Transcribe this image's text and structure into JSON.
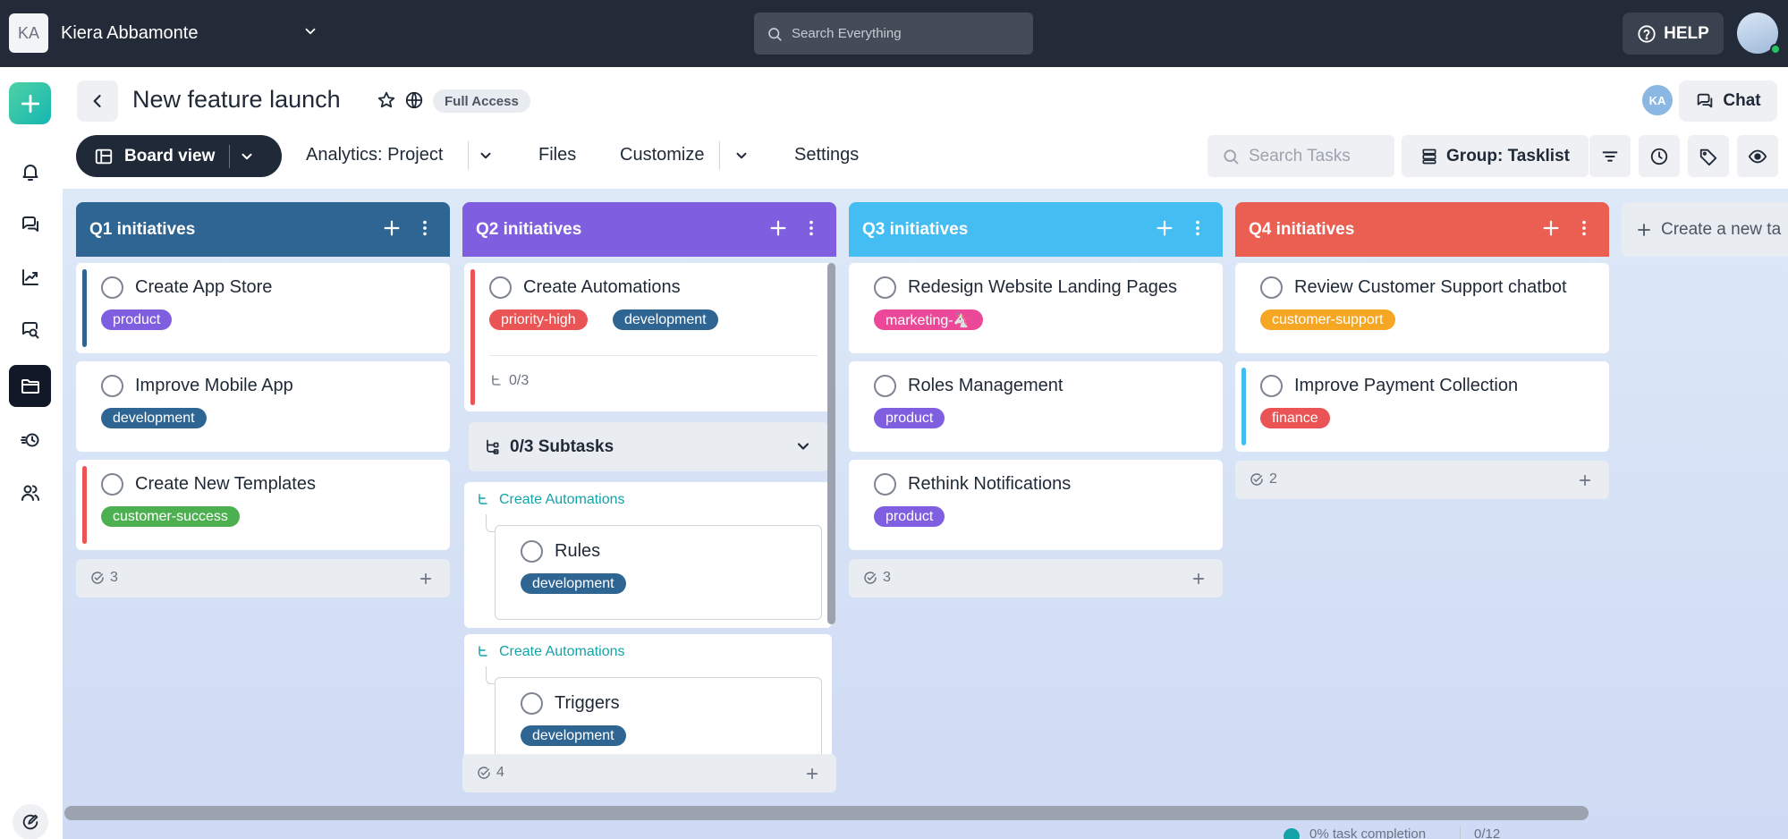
{
  "account": {
    "initials": "KA",
    "name": "Kiera Abbamonte"
  },
  "global_search": {
    "placeholder": "Search Everything"
  },
  "help": {
    "label": "HELP"
  },
  "project": {
    "title": "New feature launch",
    "access": "Full Access",
    "member_initials": "KA",
    "chat_label": "Chat"
  },
  "toolbar": {
    "view_label": "Board view",
    "analytics_label": "Analytics: Project",
    "files_label": "Files",
    "customize_label": "Customize",
    "settings_label": "Settings",
    "search_tasks_placeholder": "Search Tasks",
    "group_label": "Group: Tasklist"
  },
  "columns": [
    {
      "title": "Q1 initiatives",
      "color": "#2f6592",
      "count": "3",
      "cards": [
        {
          "title": "Create App Store",
          "tag": "product",
          "tag_color": "#7f5fe0",
          "bar": "#2f6592"
        },
        {
          "title": "Improve Mobile App",
          "tag": "development",
          "tag_color": "#2f6592",
          "bar": ""
        },
        {
          "title": "Create New Templates",
          "tag": "customer-success",
          "tag_color": "#4caf50",
          "bar": "#ea5455"
        }
      ]
    },
    {
      "title": "Q2 initiatives",
      "color": "#7f5fe0",
      "count": "4",
      "main_card": {
        "title": "Create Automations",
        "tags": [
          "priority-high",
          "development"
        ],
        "tag_colors": [
          "#ea5455",
          "#2f6592"
        ],
        "subtask_progress": "0/3"
      },
      "subtasks_label": "0/3 Subtasks",
      "subtask_groups": [
        {
          "parent": "Create Automations",
          "title": "Rules",
          "tag": "development"
        },
        {
          "parent": "Create Automations",
          "title": "Triggers",
          "tag": "development"
        }
      ]
    },
    {
      "title": "Q3 initiatives",
      "color": "#44bdf2",
      "count": "3",
      "cards": [
        {
          "title": "Redesign Website Landing Pages",
          "tag": "marketing-🦄",
          "tag_color": "#ec4899",
          "bar": ""
        },
        {
          "title": "Roles Management",
          "tag": "product",
          "tag_color": "#7f5fe0",
          "bar": ""
        },
        {
          "title": "Rethink Notifications",
          "tag": "product",
          "tag_color": "#7f5fe0",
          "bar": ""
        }
      ]
    },
    {
      "title": "Q4 initiatives",
      "color": "#ea5f52",
      "count": "2",
      "cards": [
        {
          "title": "Review Customer Support chatbot",
          "tag": "customer-support",
          "tag_color": "#f5a623",
          "bar": ""
        },
        {
          "title": "Improve Payment Collection",
          "tag": "finance",
          "tag_color": "#ea5455",
          "bar": "#44bdf2"
        }
      ]
    }
  ],
  "new_list_label": "Create a new ta",
  "footer": {
    "completion": "0% task completion",
    "ratio": "0/12"
  }
}
